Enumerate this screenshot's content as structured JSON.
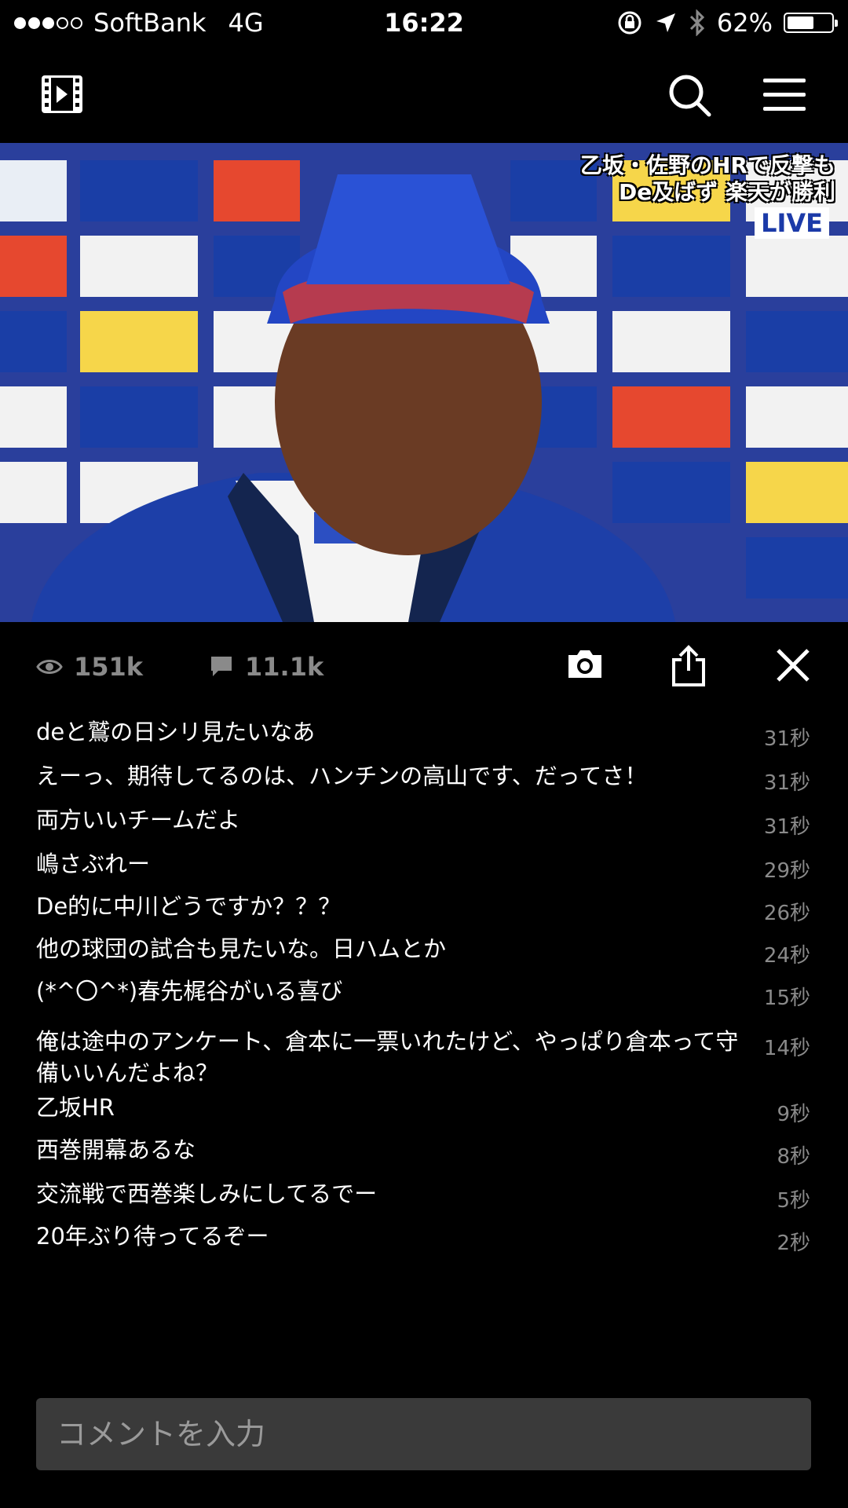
{
  "status_bar": {
    "carrier": "SoftBank",
    "network": "4G",
    "time": "16:22",
    "battery_percent": "62%",
    "battery_level": 0.62,
    "signal_bars_filled": 3,
    "signal_bars_total": 5,
    "icons": [
      "orientation-lock-icon",
      "location-arrow-icon",
      "bluetooth-icon",
      "battery-icon"
    ]
  },
  "header": {
    "logo_icon": "film-icon",
    "search_icon": "search-icon",
    "menu_icon": "hamburger-menu-icon"
  },
  "video": {
    "caption_line1": "乙坂・佐野のHRで反撃も",
    "caption_line2": "De及ばず 楽天が勝利",
    "badge": "LIVE"
  },
  "stats": {
    "views": "151k",
    "comments": "11.1k",
    "icons": [
      "eye-icon",
      "comment-bubble-icon",
      "camera-icon",
      "share-icon",
      "close-icon"
    ]
  },
  "comments": [
    {
      "text": "deと鷲の日シリ見たいなあ",
      "time": "31秒"
    },
    {
      "text": "えーっ、期待してるのは、ハンチンの高山です、だってさ！",
      "time": "31秒"
    },
    {
      "text": "両方いいチームだよ",
      "time": "31秒"
    },
    {
      "text": "嶋さぶれー",
      "time": "29秒"
    },
    {
      "text": "De的に中川どうですか？？？",
      "time": "26秒"
    },
    {
      "text": "他の球団の試合も見たいな。日ハムとか",
      "time": "24秒"
    },
    {
      "text": "(*^〇^*)春先梶谷がいる喜び",
      "time": "15秒"
    },
    {
      "text": "俺は途中のアンケート、倉本に一票いれたけど、やっぱり倉本って守備いいんだよね？",
      "time": "14秒"
    },
    {
      "text": "乙坂HR",
      "time": "9秒"
    },
    {
      "text": "西巻開幕あるな",
      "time": "8秒"
    },
    {
      "text": "交流戦で西巻楽しみにしてるでー",
      "time": "5秒"
    },
    {
      "text": "20年ぶり待ってるぞー",
      "time": "2秒"
    }
  ],
  "comment_input": {
    "placeholder": "コメントを入力"
  }
}
